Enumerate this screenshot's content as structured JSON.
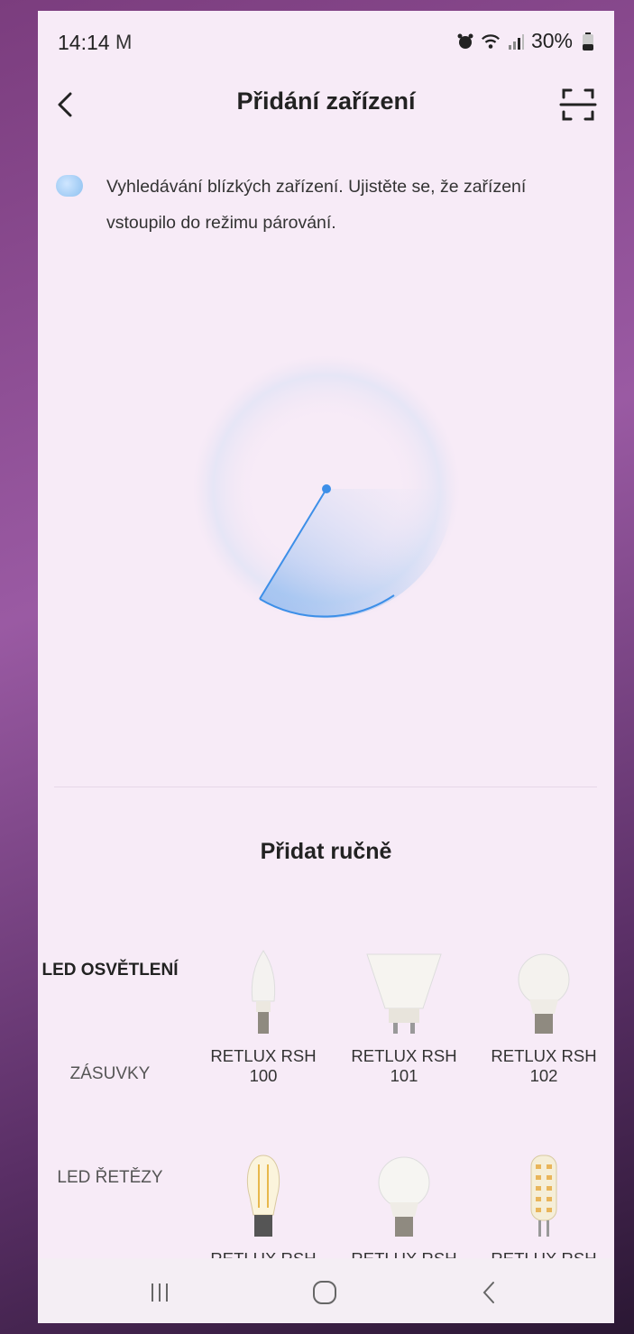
{
  "status_bar": {
    "time": "14:14",
    "battery": "30%"
  },
  "header": {
    "title": "Přidání zařízení"
  },
  "hint": {
    "text": "Vyhledávání blízkých zařízení. Ujistěte se, že zařízení vstoupilo do režimu párování."
  },
  "manual": {
    "title": "Přidat ručně"
  },
  "categories": [
    {
      "label": "LED OSVĚTLENÍ",
      "active": true
    },
    {
      "label": "ZÁSUVKY",
      "active": false
    },
    {
      "label": "LED ŘETĚZY",
      "active": false
    }
  ],
  "products": [
    {
      "name": "RETLUX RSH 100",
      "icon": "candle-bulb-icon"
    },
    {
      "name": "RETLUX RSH 101",
      "icon": "gu10-bulb-icon"
    },
    {
      "name": "RETLUX RSH 102",
      "icon": "a60-bulb-icon"
    },
    {
      "name": "RETLUX RSH",
      "icon": "filament-bulb-icon"
    },
    {
      "name": "RETLUX RSH",
      "icon": "a60-bulb-icon"
    },
    {
      "name": "RETLUX RSH",
      "icon": "g9-capsule-icon"
    }
  ],
  "colors": {
    "accent": "#3d8fe8",
    "background": "#f7ebf7"
  }
}
